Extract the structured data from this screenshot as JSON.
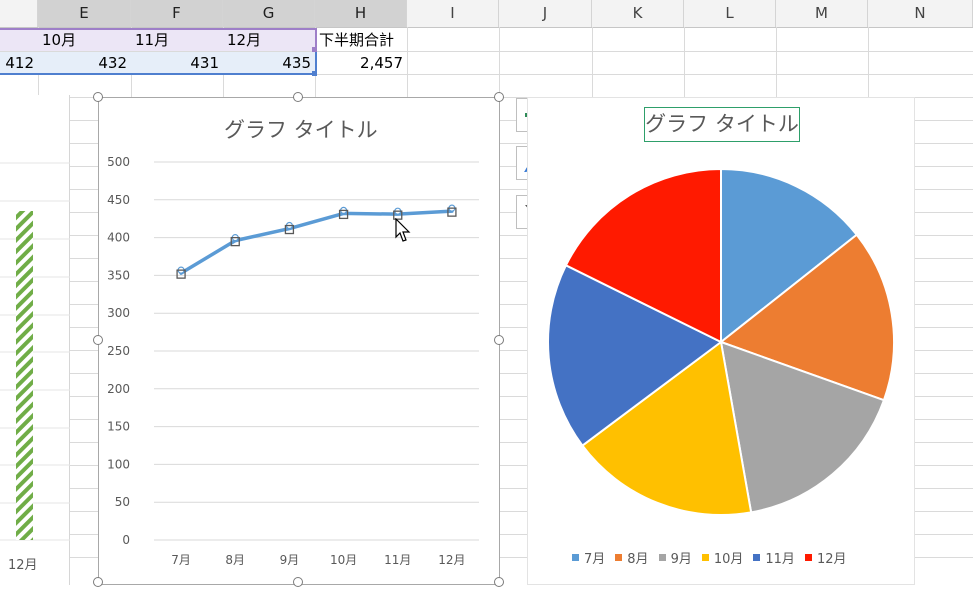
{
  "columns": [
    "E",
    "F",
    "G",
    "H",
    "I",
    "J",
    "K",
    "L",
    "M",
    "N"
  ],
  "months_row": {
    "e": "10月",
    "f": "11月",
    "g": "12月",
    "h": "下半期合計"
  },
  "values_row": {
    "d": "412",
    "e": "432",
    "f": "431",
    "g": "435",
    "h": "2,457"
  },
  "left_chart": {
    "xlabel": "12月"
  },
  "line_chart_title": "グラフ タイトル",
  "pie_chart_title": "グラフ タイトル",
  "side_buttons": {
    "add": "plus-icon",
    "style": "brush-icon",
    "filter": "filter-icon"
  },
  "chart_data": [
    {
      "type": "line",
      "title": "グラフ タイトル",
      "categories": [
        "7月",
        "8月",
        "9月",
        "10月",
        "11月",
        "12月"
      ],
      "series": [
        {
          "values": [
            353,
            396,
            412,
            432,
            431,
            435
          ],
          "color": "#5b9bd5"
        }
      ],
      "ylim": [
        0,
        500
      ],
      "yticks": [
        0,
        50,
        100,
        150,
        200,
        250,
        300,
        350,
        400,
        450,
        500
      ],
      "grid": true
    },
    {
      "type": "pie",
      "title": "グラフ タイトル",
      "categories": [
        "7月",
        "8月",
        "9月",
        "10月",
        "11月",
        "12月"
      ],
      "values": [
        353,
        396,
        412,
        432,
        431,
        435
      ],
      "colors": [
        "#5b9bd5",
        "#ed7d31",
        "#a5a5a5",
        "#ffc000",
        "#4472c4",
        "#ff1a00"
      ],
      "legend": "bottom"
    }
  ]
}
